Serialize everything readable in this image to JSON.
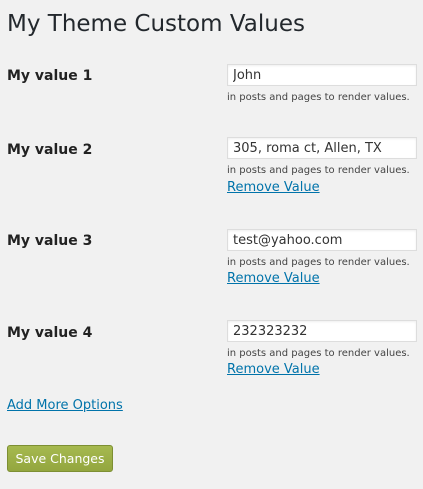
{
  "page": {
    "title": "My Theme Custom Values"
  },
  "rows": [
    {
      "label": "My value 1",
      "value": "John",
      "description": "in posts and pages to render values.",
      "remove_label": ""
    },
    {
      "label": "My value 2",
      "value": "305, roma ct, Allen, TX",
      "description": "in posts and pages to render values.",
      "remove_label": "Remove Value"
    },
    {
      "label": "My value 3",
      "value": "test@yahoo.com",
      "description": "in posts and pages to render values.",
      "remove_label": "Remove Value"
    },
    {
      "label": "My value 4",
      "value": "232323232",
      "description": "in posts and pages to render values.",
      "remove_label": "Remove Value"
    }
  ],
  "actions": {
    "add_more_label": "Add More Options",
    "save_label": "Save Changes"
  },
  "colors": {
    "background": "#f1f1f1",
    "link": "#0073aa",
    "save_button": "#9bae47"
  }
}
